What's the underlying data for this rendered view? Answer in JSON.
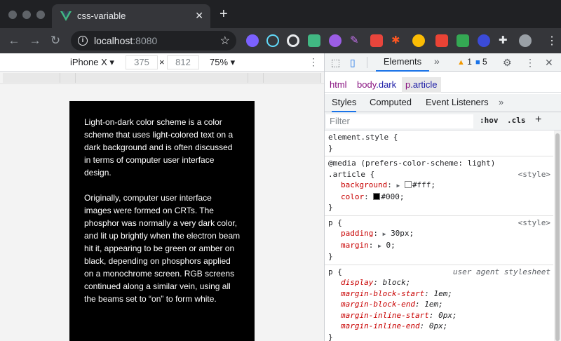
{
  "browser": {
    "tab_title": "css-variable",
    "address_host": "localhost",
    "address_port": ":8080",
    "theme": {
      "frame": "#202124",
      "toolbar": "#35363a",
      "vue_green": "#41b883"
    }
  },
  "device_toolbar": {
    "device": "iPhone X",
    "width": "375",
    "times": "×",
    "height": "812",
    "zoom": "75%"
  },
  "article": {
    "paragraphs": [
      "Light-on-dark color scheme is a color scheme that uses light-colored text on a dark background and is often discussed in terms of computer user interface design.",
      "Originally, computer user interface images were formed on CRTs. The phosphor was normally a very dark color, and lit up brightly when the electron beam hit it, appearing to be green or amber on black, depending on phosphors applied on a monochrome screen. RGB screens continued along a similar vein, using all the beams set to “on” to form white."
    ]
  },
  "devtools": {
    "main_tab": "Elements",
    "warnings": "1",
    "messages": "5",
    "breadcrumbs": {
      "html": "html",
      "body_tag": "body",
      "body_class": ".dark",
      "p_tag": "p",
      "p_class": ".article"
    },
    "subtabs": {
      "styles": "Styles",
      "computed": "Computed",
      "listeners": "Event Listeners"
    },
    "filter": {
      "placeholder": "Filter",
      "hov": ":hov",
      "cls": ".cls",
      "add": "+"
    },
    "rules": {
      "element_style": {
        "selector": "element.style {",
        "close": "}"
      },
      "media_rule": {
        "media": "@media (prefers-color-scheme: light)",
        "selector": ".article {",
        "source": "<style>",
        "background_prop": "background",
        "background_val": "#fff;",
        "color_prop": "color",
        "color_val": "#000;",
        "close": "}",
        "swatch_light": "#ffffff",
        "swatch_dark": "#000000"
      },
      "p_rule": {
        "selector": "p {",
        "source": "<style>",
        "padding_prop": "padding",
        "padding_val": "30px;",
        "margin_prop": "margin",
        "margin_val": "0;",
        "close": "}"
      },
      "ua_rule": {
        "selector": "p {",
        "source": "user agent stylesheet",
        "display_prop": "display",
        "display_val": "block;",
        "mbs_prop": "margin-block-start",
        "mbs_val": "1em;",
        "mbe_prop": "margin-block-end",
        "mbe_val": "1em;",
        "mis_prop": "margin-inline-start",
        "mis_val": "0px;",
        "mie_prop": "margin-inline-end",
        "mie_val": "0px;",
        "close": "}"
      }
    }
  }
}
